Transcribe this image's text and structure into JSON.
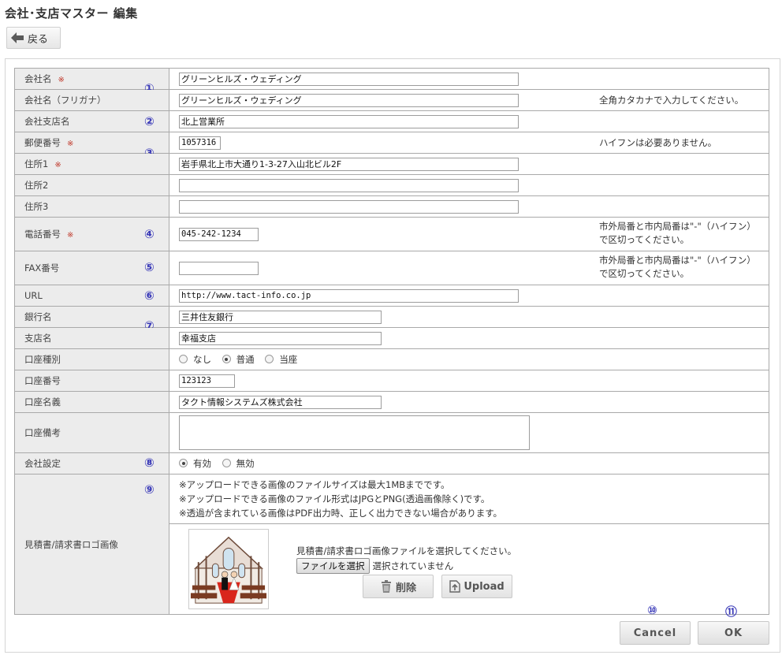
{
  "page": {
    "title": "会社･支店マスター 編集",
    "back_label": "戻る"
  },
  "form": {
    "company_name": {
      "label": "会社名",
      "required_mark": "※",
      "value": "グリーンヒルズ・ウェディング",
      "marker": "①"
    },
    "company_kana": {
      "label": "会社名（フリガナ）",
      "value": "グリーンヒルズ・ウェディング",
      "note": "全角カタカナで入力してください。"
    },
    "branch_name": {
      "label": "会社支店名",
      "value": "北上営業所",
      "marker": "②"
    },
    "postal_code": {
      "label": "郵便番号",
      "required_mark": "※",
      "value": "1057316",
      "note": "ハイフンは必要ありません。",
      "marker": "③"
    },
    "address1": {
      "label": "住所1",
      "required_mark": "※",
      "value": "岩手県北上市大通り1-3-27入山北ビル2F"
    },
    "address2": {
      "label": "住所2",
      "value": ""
    },
    "address3": {
      "label": "住所3",
      "value": ""
    },
    "phone": {
      "label": "電話番号",
      "required_mark": "※",
      "value": "045-242-1234",
      "note_line1": "市外局番と市内局番は\"-\"（ハイフン）",
      "note_line2": "で区切ってください。",
      "marker": "④"
    },
    "fax": {
      "label": "FAX番号",
      "value": "",
      "note_line1": "市外局番と市内局番は\"-\"（ハイフン）",
      "note_line2": "で区切ってください。",
      "marker": "⑤"
    },
    "url": {
      "label": "URL",
      "value": "http://www.tact-info.co.jp",
      "marker": "⑥"
    },
    "bank_name": {
      "label": "銀行名",
      "value": "三井住友銀行",
      "marker": "⑦"
    },
    "bank_branch": {
      "label": "支店名",
      "value": "幸福支店"
    },
    "account_type": {
      "label": "口座種別",
      "options": [
        "なし",
        "普通",
        "当座"
      ],
      "selected": "普通"
    },
    "account_number": {
      "label": "口座番号",
      "value": "123123"
    },
    "account_holder": {
      "label": "口座名義",
      "value": "タクト情報システムズ株式会社"
    },
    "account_memo": {
      "label": "口座備考",
      "value": ""
    },
    "company_setting": {
      "label": "会社設定",
      "options": [
        "有効",
        "無効"
      ],
      "selected": "有効",
      "marker": "⑧"
    },
    "logo": {
      "label": "見積書/請求書ロゴ画像",
      "marker": "⑨",
      "notes": [
        "※アップロードできる画像のファイルサイズは最大1MBまでです。",
        "※アップロードできる画像のファイル形式はJPGとPNG(透過画像除く)です。",
        "※透過が含まれている画像はPDF出力時、正しく出力できない場合があります。"
      ],
      "prompt": "見積書/請求書ロゴ画像ファイルを選択してください。",
      "file_button": "ファイルを選択",
      "file_status": "選択されていません",
      "delete_label": "削除",
      "upload_label": "Upload"
    }
  },
  "footer": {
    "cancel_label": "Cancel",
    "ok_label": "OK",
    "cancel_marker": "⑩",
    "ok_marker": "⑪"
  }
}
